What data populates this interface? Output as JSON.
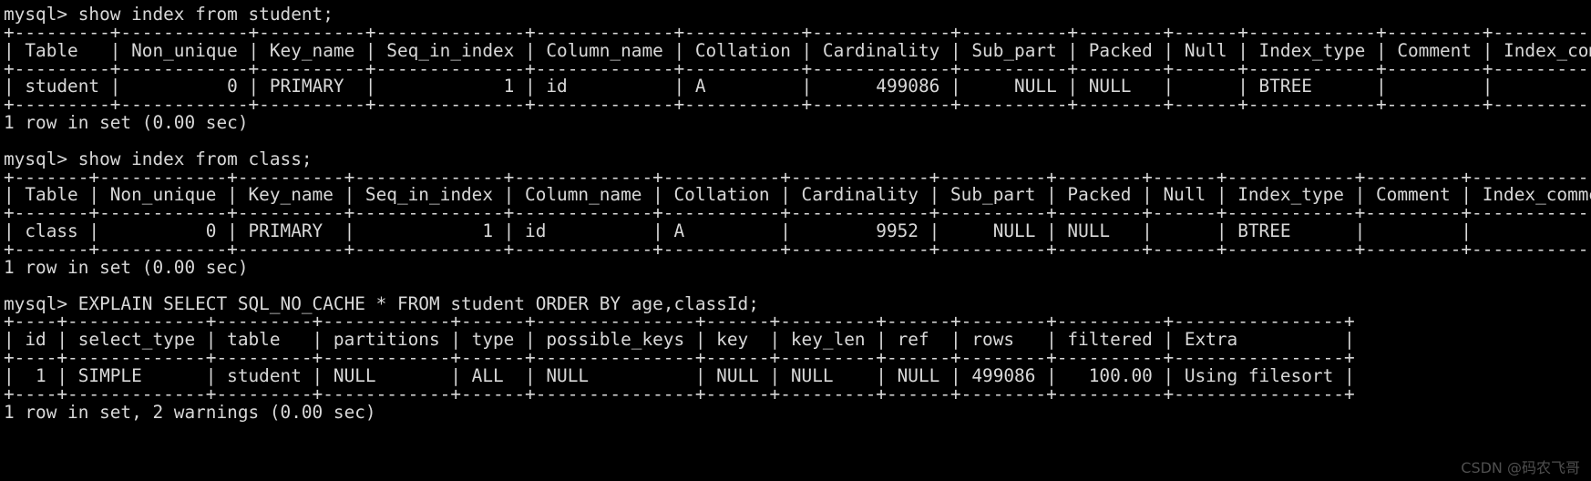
{
  "terminal": {
    "prompt": "mysql> ",
    "background_color": "#000000",
    "text_color": "#d8d8d8",
    "watermark": "CSDN @码农飞哥"
  },
  "blocks": [
    {
      "name": "show-index-student",
      "command": "mysql> show index from student;",
      "separator": "+---------+------------+----------+--------------+-------------+-----------+-------------+----------+--------+------+------------+---------+---------------+",
      "header": "| Table   | Non_unique | Key_name | Seq_in_index | Column_name | Collation | Cardinality | Sub_part | Packed | Null | Index_type | Comment | Index_comment |",
      "rows": [
        "| student |          0 | PRIMARY  |            1 | id          | A         |      499086 |     NULL | NULL   |      | BTREE      |         |               |"
      ],
      "footer": "1 row in set (0.00 sec)",
      "columns": [
        "Table",
        "Non_unique",
        "Key_name",
        "Seq_in_index",
        "Column_name",
        "Collation",
        "Cardinality",
        "Sub_part",
        "Packed",
        "Null",
        "Index_type",
        "Comment",
        "Index_comment"
      ],
      "values": [
        "student",
        "0",
        "PRIMARY",
        "1",
        "id",
        "A",
        "499086",
        "NULL",
        "NULL",
        "",
        "BTREE",
        "",
        ""
      ]
    },
    {
      "name": "show-index-class",
      "command": "mysql> show index from class;",
      "separator": "+-------+------------+----------+--------------+-------------+-----------+-------------+----------+--------+------+------------+---------+---------------+",
      "header": "| Table | Non_unique | Key_name | Seq_in_index | Column_name | Collation | Cardinality | Sub_part | Packed | Null | Index_type | Comment | Index_comment |",
      "rows": [
        "| class |          0 | PRIMARY  |            1 | id          | A         |        9952 |     NULL | NULL   |      | BTREE      |         |               |"
      ],
      "footer": "1 row in set (0.00 sec)",
      "columns": [
        "Table",
        "Non_unique",
        "Key_name",
        "Seq_in_index",
        "Column_name",
        "Collation",
        "Cardinality",
        "Sub_part",
        "Packed",
        "Null",
        "Index_type",
        "Comment",
        "Index_comment"
      ],
      "values": [
        "class",
        "0",
        "PRIMARY",
        "1",
        "id",
        "A",
        "9952",
        "NULL",
        "NULL",
        "",
        "BTREE",
        "",
        ""
      ]
    },
    {
      "name": "explain-select-student",
      "command": "mysql> EXPLAIN SELECT SQL_NO_CACHE * FROM student ORDER BY age,classId;",
      "separator": "+----+-------------+---------+------------+------+---------------+------+---------+------+--------+----------+----------------+",
      "header": "| id | select_type | table   | partitions | type | possible_keys | key  | key_len | ref  | rows   | filtered | Extra          |",
      "rows": [
        "|  1 | SIMPLE      | student | NULL       | ALL  | NULL          | NULL | NULL    | NULL | 499086 |   100.00 | Using filesort |"
      ],
      "footer": "1 row in set, 2 warnings (0.00 sec)",
      "columns": [
        "id",
        "select_type",
        "table",
        "partitions",
        "type",
        "possible_keys",
        "key",
        "key_len",
        "ref",
        "rows",
        "filtered",
        "Extra"
      ],
      "values": [
        "1",
        "SIMPLE",
        "student",
        "NULL",
        "ALL",
        "NULL",
        "NULL",
        "NULL",
        "NULL",
        "499086",
        "100.00",
        "Using filesort"
      ]
    }
  ]
}
